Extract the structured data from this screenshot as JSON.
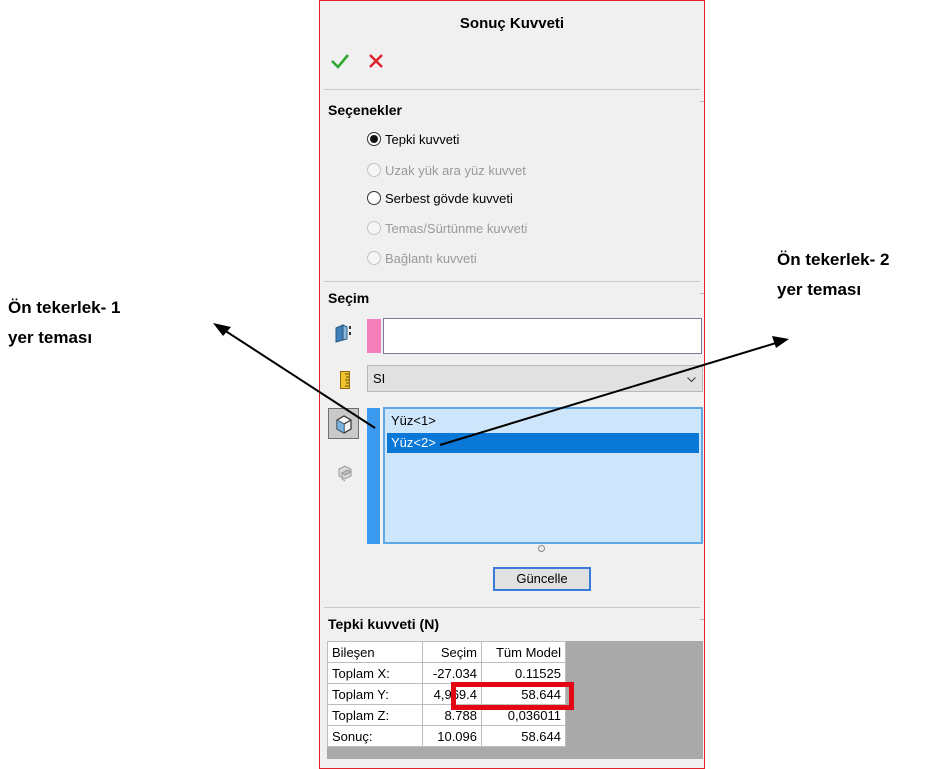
{
  "panel": {
    "title": "Sonuç Kuvveti",
    "options_title": "Seçenekler",
    "options": [
      {
        "label": "Tepki kuvveti",
        "checked": true,
        "enabled": true
      },
      {
        "label": "Uzak yük ara yüz kuvvet",
        "checked": false,
        "enabled": false
      },
      {
        "label": "Serbest gövde kuvveti",
        "checked": false,
        "enabled": true
      },
      {
        "label": "Temas/Sürtünme kuvveti",
        "checked": false,
        "enabled": false
      },
      {
        "label": "Bağlantı kuvveti",
        "checked": false,
        "enabled": false
      }
    ],
    "selection_title": "Seçim",
    "face_input_value": "",
    "unit": "SI",
    "faces": [
      "Yüz<1>",
      "Yüz<2>"
    ],
    "selected_face": "Yüz<2>",
    "update_label": "Güncelle",
    "results_title": "Tepki kuvveti (N)",
    "colors": {
      "accent": "#0a78d6",
      "highlight": "#e30613",
      "ok": "#2ea82e",
      "cancel": "#e0232b"
    }
  },
  "results": {
    "headers": [
      "Bileşen",
      "Seçim",
      "Tüm Model"
    ],
    "rows": [
      [
        "Toplam X:",
        "-27.034",
        "0.11525"
      ],
      [
        "Toplam Y:",
        "4,969.4",
        "58.644"
      ],
      [
        "Toplam Z:",
        "8.788",
        "0,036011"
      ],
      [
        "Sonuç:",
        "10.096",
        "58.644"
      ]
    ]
  },
  "annotations": {
    "left": [
      "Ön tekerlek- 1",
      "yer teması"
    ],
    "right": [
      "Ön tekerlek- 2",
      "yer teması"
    ]
  }
}
